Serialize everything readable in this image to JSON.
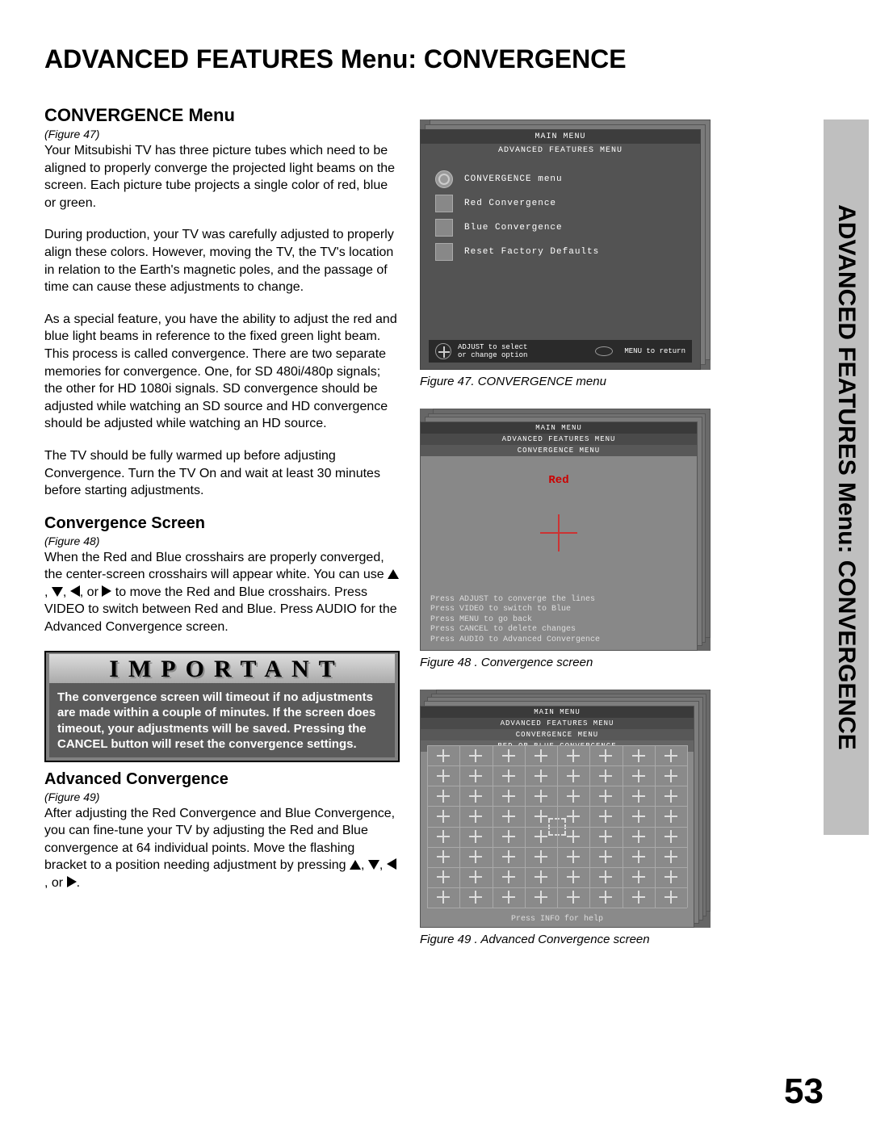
{
  "page_title": "ADVANCED FEATURES Menu: CONVERGENCE",
  "side_tab": "ADVANCED FEATURES Menu: CONVERGENCE",
  "page_number": "53",
  "left": {
    "section1_heading": "CONVERGENCE Menu",
    "section1_figref": "(Figure 47)",
    "section1_p1": "Your Mitsubishi TV has three picture tubes which need to be aligned to properly converge the projected light beams on the screen.  Each picture tube projects a single color of red, blue or green.",
    "section1_p2": "During production, your TV was carefully adjusted to properly align these colors.  However, moving the TV, the TV's location in relation to the Earth's magnetic poles, and the passage of time can cause these adjustments to change.",
    "section1_p3": "As a special feature, you have the ability to adjust the red and blue light beams in reference to the fixed green light beam. This process is called convergence. There are two separate memories for convergence. One, for SD 480i/480p signals; the other for HD 1080i signals.  SD convergence should be adjusted while watching an SD source and HD convergence should be adjusted while watching an HD source.",
    "section1_p4": "The TV should be fully warmed up before adjusting Convergence.  Turn the TV On and wait at least 30 minutes before starting adjustments.",
    "section2_heading": "Convergence Screen",
    "section2_figref": "(Figure 48)",
    "section2_p1a": "When the Red and Blue crosshairs are properly converged, the center-screen crosshairs will appear white.  You can use ",
    "section2_p1b": " to move the Red and Blue crosshairs.  Press VIDEO to switch between Red and Blue.  Press AUDIO for the Advanced Convergence screen.",
    "important_title": "IMPORTANT",
    "important_text": "The convergence screen will timeout if no adjustments are made within a couple of minutes.  If the screen does timeout, your adjustments will be saved.  Pressing the CANCEL button will reset the convergence settings.",
    "section3_heading": "Advanced Convergence",
    "section3_figref": "(Figure 49)",
    "section3_p1a": "After adjusting the Red Convergence and Blue Convergence, you can fine-tune your TV by adjusting the Red and Blue convergence at 64 individual points.  Move the flashing bracket to a position needing adjustment by pressing ",
    "section3_p1b": " or "
  },
  "fig47": {
    "header1": "MAIN MENU",
    "header2": "ADVANCED FEATURES MENU",
    "item1": "CONVERGENCE menu",
    "item2": "Red Convergence",
    "item3": "Blue Convergence",
    "item4": "Reset Factory Defaults",
    "footer_left1": "ADJUST to select",
    "footer_left2": "or change option",
    "footer_right": "MENU to return",
    "caption": "Figure 47.  CONVERGENCE menu"
  },
  "fig48": {
    "h1": "MAIN MENU",
    "h2": "ADVANCED FEATURES MENU",
    "h3": "CONVERGENCE MENU",
    "red_label": "Red",
    "press1": "Press ADJUST to converge the lines",
    "press2": "Press VIDEO to switch to Blue",
    "press3": "Press MENU to go back",
    "press4": "Press CANCEL to delete changes",
    "press5": "Press AUDIO to Advanced Convergence",
    "caption": "Figure 48 .  Convergence screen"
  },
  "fig49": {
    "h1": "MAIN MENU",
    "h2": "ADVANCED FEATURES MENU",
    "h3": "CONVERGENCE MENU",
    "h4": "RED OR BLUE CONVERGENCE",
    "footer": "Press INFO for help",
    "caption": "Figure  49 .  Advanced Convergence screen"
  }
}
